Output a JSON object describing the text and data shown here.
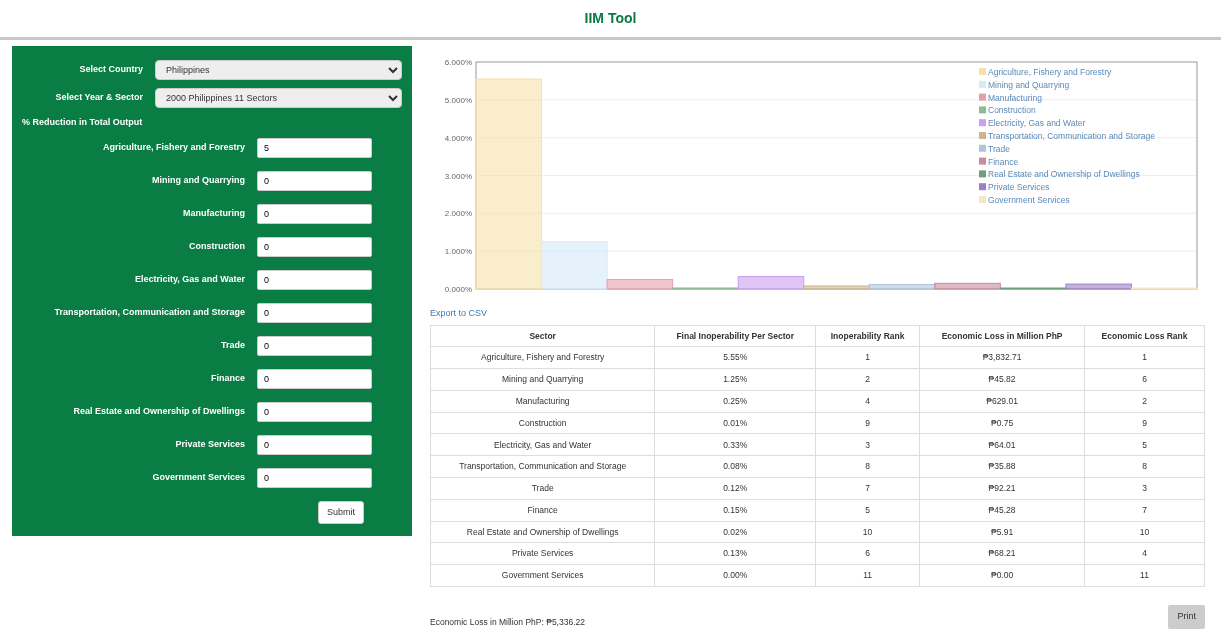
{
  "title": "IIM Tool",
  "form": {
    "country_label": "Select Country",
    "country": "Philippines",
    "year_label": "Select Year & Sector",
    "year": "2000 Philippines 11 Sectors",
    "section_label": "% Reduction in Total Output",
    "inputs": [
      {
        "label": "Agriculture, Fishery and Forestry",
        "value": "5"
      },
      {
        "label": "Mining and Quarrying",
        "value": "0"
      },
      {
        "label": "Manufacturing",
        "value": "0"
      },
      {
        "label": "Construction",
        "value": "0"
      },
      {
        "label": "Electricity, Gas and Water",
        "value": "0"
      },
      {
        "label": "Transportation, Communication and Storage",
        "value": "0"
      },
      {
        "label": "Trade",
        "value": "0"
      },
      {
        "label": "Finance",
        "value": "0"
      },
      {
        "label": "Real Estate and Ownership of Dwellings",
        "value": "0"
      },
      {
        "label": "Private Services",
        "value": "0"
      },
      {
        "label": "Government Services",
        "value": "0"
      }
    ],
    "submit": "Submit"
  },
  "chart_data": {
    "type": "bar",
    "grid": true,
    "legend": true,
    "ylim": [
      0,
      6
    ],
    "yticks": [
      {
        "value": 0,
        "label": "0.000%"
      },
      {
        "value": 1,
        "label": "1.000%"
      },
      {
        "value": 2,
        "label": "2.000%"
      },
      {
        "value": 3,
        "label": "3.000%"
      },
      {
        "value": 4,
        "label": "4.000%"
      },
      {
        "value": 5,
        "label": "5.000%"
      },
      {
        "value": 6,
        "label": "6.000%"
      }
    ],
    "series": [
      {
        "name": "Agriculture, Fishery and Forestry",
        "color": "#f7e1a8",
        "values": [
          5.55
        ]
      },
      {
        "name": "Mining and Quarrying",
        "color": "#d6eaf8",
        "values": [
          1.25
        ]
      },
      {
        "name": "Manufacturing",
        "color": "#e8a0a8",
        "values": [
          0.25
        ]
      },
      {
        "name": "Construction",
        "color": "#8fbc8f",
        "values": [
          0.01
        ]
      },
      {
        "name": "Electricity, Gas and Water",
        "color": "#c9a0f0",
        "values": [
          0.33
        ]
      },
      {
        "name": "Transportation, Communication and Storage",
        "color": "#d2b48c",
        "values": [
          0.08
        ]
      },
      {
        "name": "Trade",
        "color": "#b0c4de",
        "values": [
          0.12
        ]
      },
      {
        "name": "Finance",
        "color": "#c98a9a",
        "values": [
          0.15
        ]
      },
      {
        "name": "Real Estate and Ownership of Dwellings",
        "color": "#6f9f7f",
        "values": [
          0.02
        ]
      },
      {
        "name": "Private Services",
        "color": "#9b7fc7",
        "values": [
          0.13
        ]
      },
      {
        "name": "Government Services",
        "color": "#f5e6c8",
        "values": [
          0.0
        ]
      }
    ]
  },
  "export_link": "Export to CSV",
  "table": {
    "columns": [
      "Sector",
      "Final Inoperability Per Sector",
      "Inoperability Rank",
      "Economic Loss in Million PhP",
      "Economic Loss Rank"
    ],
    "rows": [
      [
        "Agriculture, Fishery and Forestry",
        "5.55%",
        "1",
        "₱3,832.71",
        "1"
      ],
      [
        "Mining and Quarrying",
        "1.25%",
        "2",
        "₱45.82",
        "6"
      ],
      [
        "Manufacturing",
        "0.25%",
        "4",
        "₱629.01",
        "2"
      ],
      [
        "Construction",
        "0.01%",
        "9",
        "₱0.75",
        "9"
      ],
      [
        "Electricity, Gas and Water",
        "0.33%",
        "3",
        "₱64.01",
        "5"
      ],
      [
        "Transportation, Communication and Storage",
        "0.08%",
        "8",
        "₱35.88",
        "8"
      ],
      [
        "Trade",
        "0.12%",
        "7",
        "₱92.21",
        "3"
      ],
      [
        "Finance",
        "0.15%",
        "5",
        "₱45.28",
        "7"
      ],
      [
        "Real Estate and Ownership of Dwellings",
        "0.02%",
        "10",
        "₱5.91",
        "10"
      ],
      [
        "Private Services",
        "0.13%",
        "6",
        "₱68.21",
        "4"
      ],
      [
        "Government Services",
        "0.00%",
        "11",
        "₱0.00",
        "11"
      ]
    ]
  },
  "total": "Economic Loss in Million PhP: ₱5,336.22",
  "print": "Print"
}
